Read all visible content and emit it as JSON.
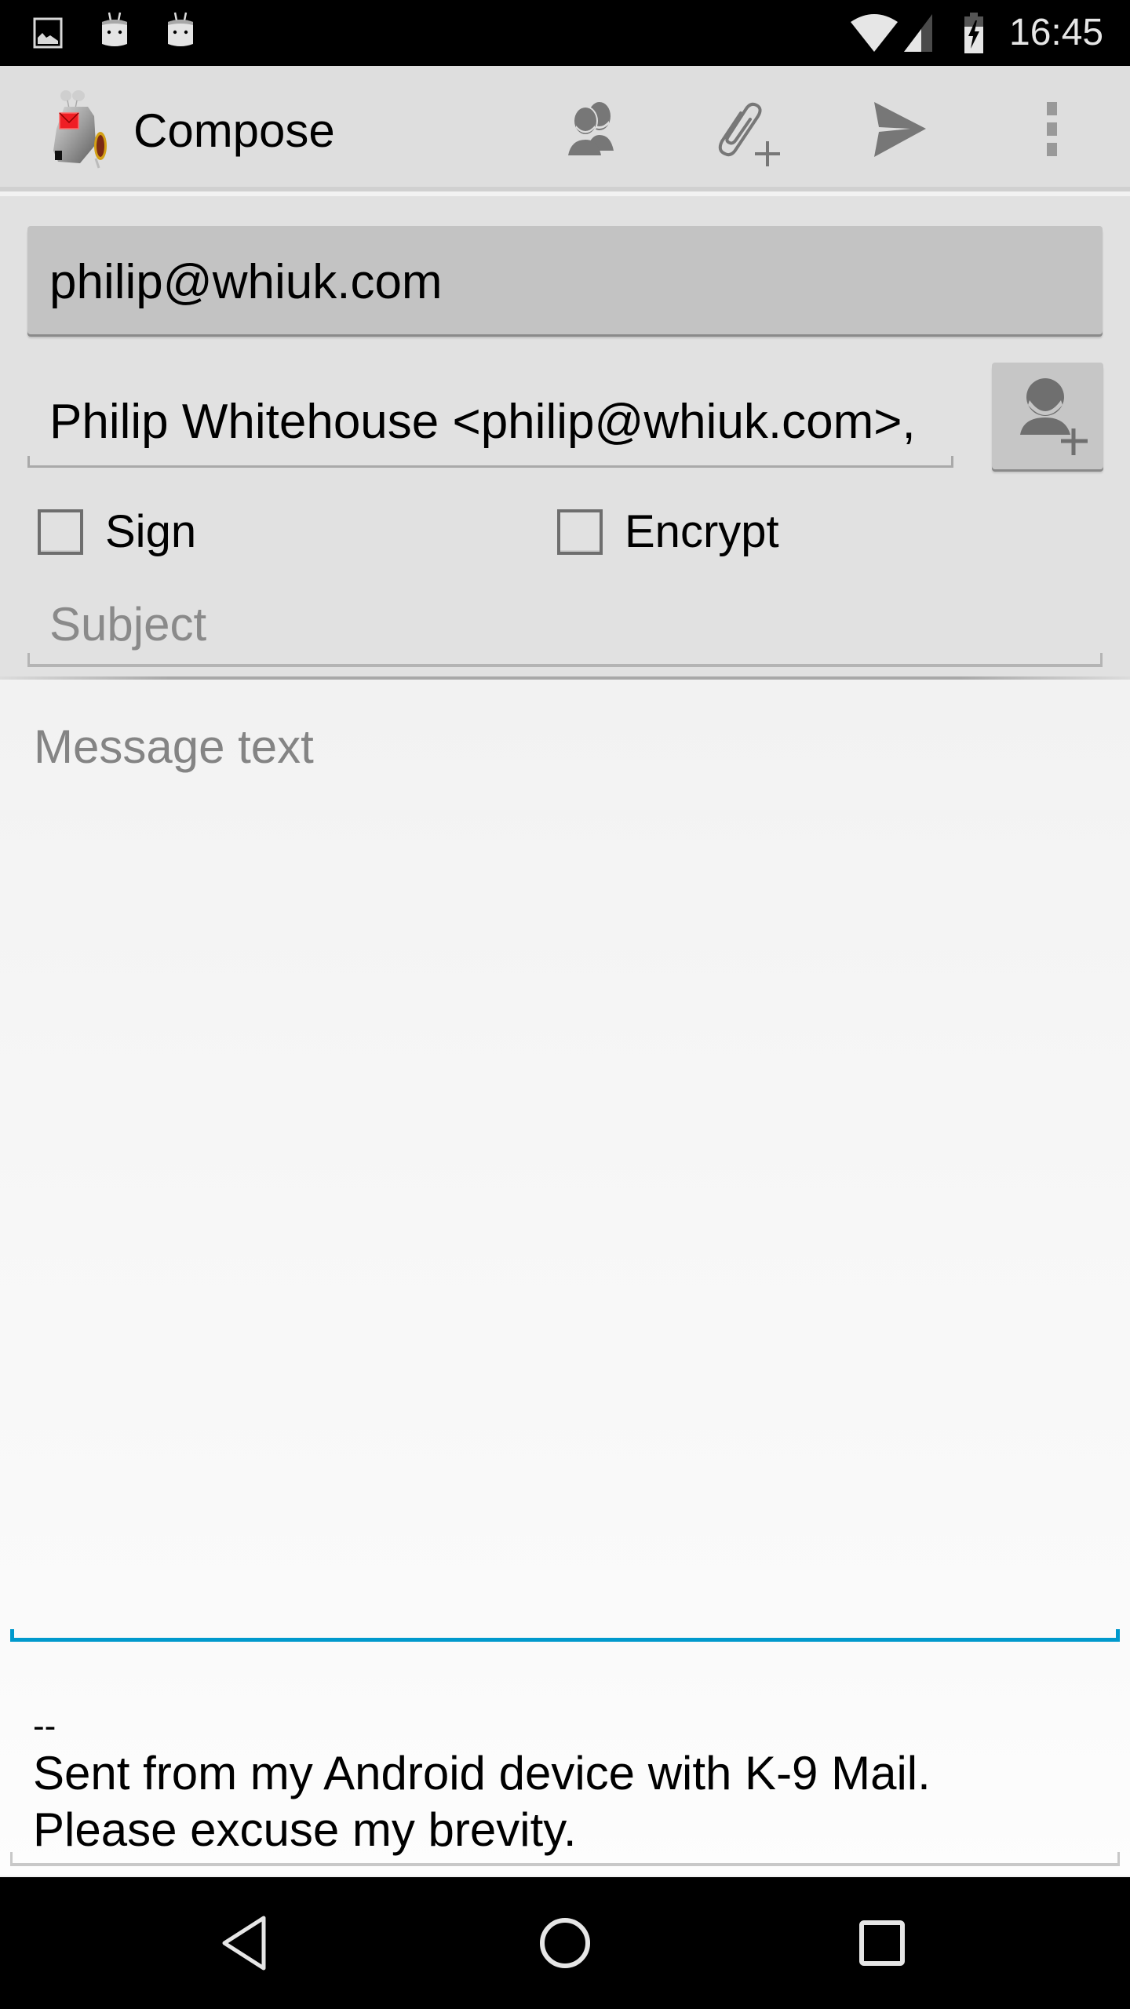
{
  "status_bar": {
    "notification_icons": [
      "gallery-icon",
      "android-debug-icon",
      "android-debug-icon"
    ],
    "system_icons": [
      "wifi-icon",
      "cell-signal-icon",
      "battery-charging-icon"
    ],
    "time": "16:45"
  },
  "action_bar": {
    "app_icon": "k9-mail-logo",
    "title": "Compose",
    "actions": [
      {
        "name": "add-from-contacts",
        "icon": "contacts-icon"
      },
      {
        "name": "add-attachment",
        "icon": "attachment-add-icon"
      },
      {
        "name": "send",
        "icon": "send-icon"
      },
      {
        "name": "more-options",
        "icon": "overflow-menu-icon"
      }
    ]
  },
  "compose_form": {
    "from_account": "philip@whiuk.com",
    "to_recipients": "Philip Whitehouse <philip@whiuk.com>,",
    "add_contact_icon": "add-contact-icon",
    "sign": {
      "label": "Sign",
      "checked": false
    },
    "encrypt": {
      "label": "Encrypt",
      "checked": false
    },
    "subject": {
      "value": "",
      "placeholder": "Subject"
    },
    "message": {
      "value": "",
      "placeholder": "Message text"
    },
    "signature": {
      "separator": "--",
      "line1": "Sent from my Android device with K-9 Mail.",
      "line2": "Please excuse my brevity."
    }
  },
  "colors": {
    "accent": "#0099cc",
    "action_bar_bg": "#dedede",
    "icon_gray": "#777777"
  },
  "nav_bar": {
    "buttons": [
      "back-icon",
      "home-icon",
      "recents-icon"
    ]
  }
}
